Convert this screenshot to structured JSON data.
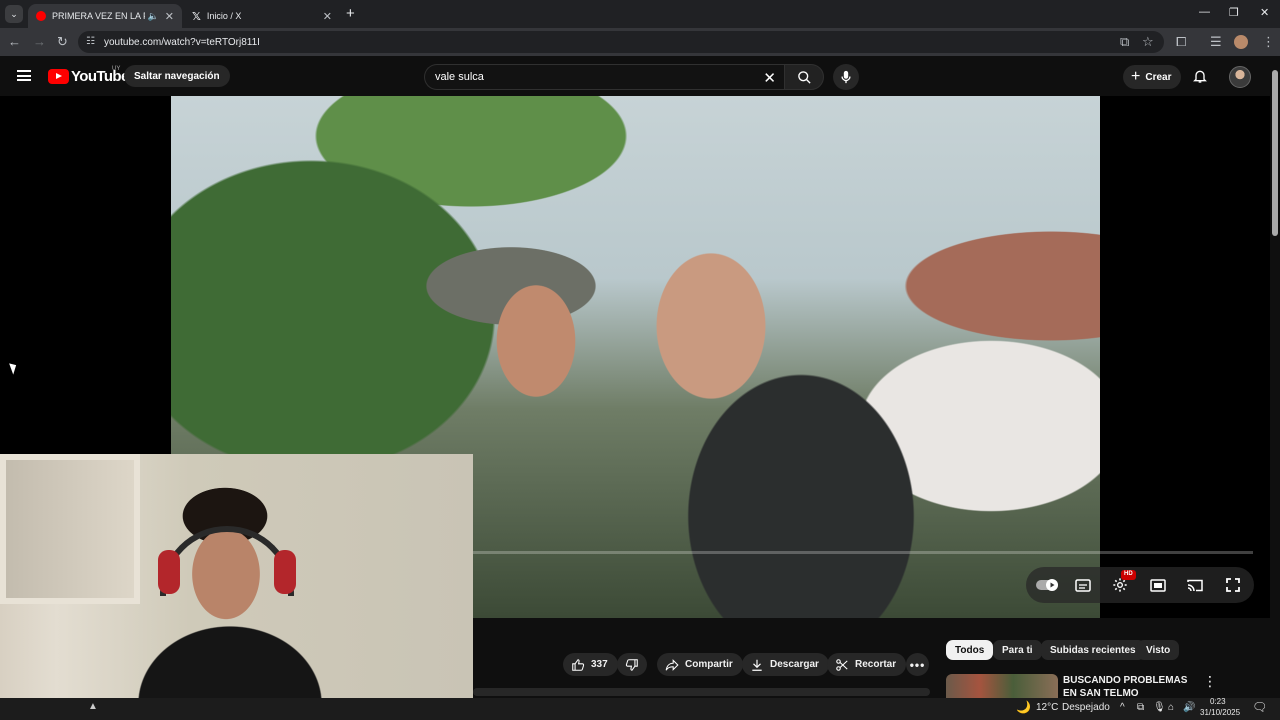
{
  "browser": {
    "tabs": [
      {
        "title": "PRIMERA VEZ EN LA FIESTA",
        "favicon_color": "#ff0000",
        "active": true,
        "audio": true
      },
      {
        "title": "Inicio / X",
        "favicon_color": "#000000",
        "active": false,
        "audio": false
      }
    ],
    "url": "youtube.com/watch?v=teRTOrj811I",
    "icons": [
      "tab-search-icon",
      "new-tab-icon",
      "minimize-icon",
      "restore-icon",
      "close-window-icon",
      "back-icon",
      "forward-icon",
      "reload-icon",
      "site-info-icon",
      "install-app-icon",
      "bookmark-star-icon",
      "extensions-icon",
      "reading-list-icon",
      "profile-icon",
      "browser-menu-icon"
    ]
  },
  "youtube": {
    "logo_text": "YouTube",
    "country_code": "UY",
    "skip_nav_label": "Saltar navegación",
    "search_value": "vale sulca",
    "create_label": "Crear",
    "brand_color": "#ff0000"
  },
  "player": {
    "quality_badge": "HD",
    "progress_fraction": 0.0
  },
  "actions": {
    "like_count": "337",
    "share_label": "Compartir",
    "download_label": "Descargar",
    "clip_label": "Recortar"
  },
  "filters": {
    "chips": [
      "Todos",
      "Para ti",
      "Subidas recientes",
      "Visto"
    ],
    "selected": "Todos"
  },
  "recommendation": {
    "title": "BUSCANDO PROBLEMAS EN SAN TELMO"
  },
  "taskbar": {
    "temperature": "12°C",
    "weather": "Despejado",
    "time": "0:23",
    "date": "31/10/2025"
  }
}
